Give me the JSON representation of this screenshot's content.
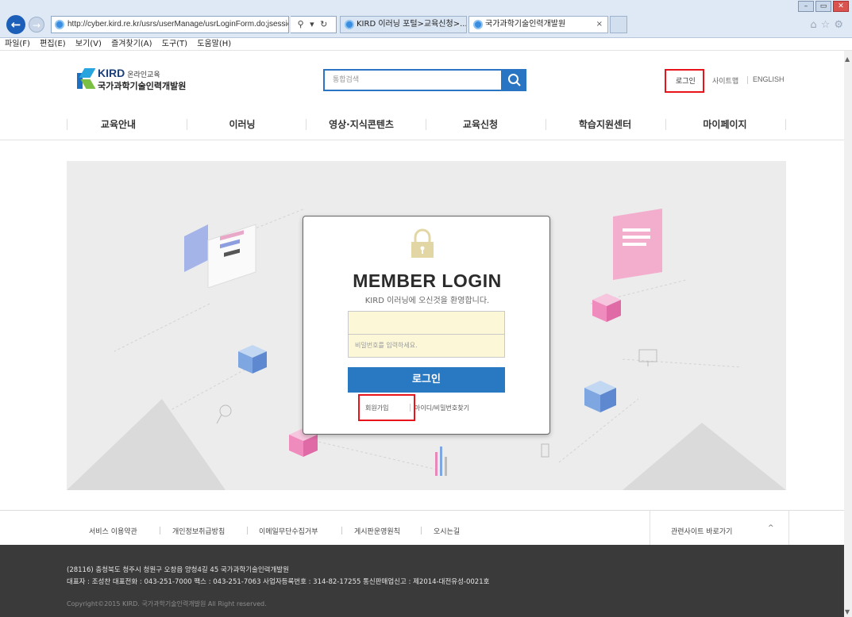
{
  "browser": {
    "url": "http://cyber.kird.re.kr/usrs/userManage/usrLoginForm.do;jsessic",
    "address_controls": "⚲ ▾ ↻",
    "tabs": [
      {
        "label": "KIRD 이러닝 포털>교육신청>...",
        "active": false
      },
      {
        "label": "국가과학기술인력개발원",
        "active": true
      }
    ],
    "tab_close": "×",
    "menu": [
      "파일(F)",
      "편집(E)",
      "보기(V)",
      "즐겨찾기(A)",
      "도구(T)",
      "도움말(H)"
    ]
  },
  "header": {
    "logo_brand": "KIRD",
    "logo_tag": "온라인교육",
    "logo_org": "국가과학기술인력개발원",
    "search_placeholder": "통합검색",
    "util": {
      "login": "로그인",
      "sitemap": "사이트맵",
      "english": "ENGLISH"
    }
  },
  "gnb": [
    "교육안내",
    "이러닝",
    "영상·지식콘텐츠",
    "교육신청",
    "학습지원센터",
    "마이페이지"
  ],
  "login": {
    "title": "MEMBER LOGIN",
    "subtitle": "KIRD 이러닝에 오신것을 환영합니다.",
    "id_value": "",
    "pw_placeholder": "비밀번호를 입력하세요.",
    "button": "로그인",
    "join": "회원가입",
    "find": "아이디/비밀번호찾기"
  },
  "footer": {
    "links": [
      "서비스 이용약관",
      "개인정보취급방침",
      "이메일무단수집거부",
      "게시판운영원칙",
      "오시는길"
    ],
    "related": "관련사이트 바로가기",
    "related_caret": "^",
    "address": "(28116) 충청북도 청주시 청원구 오창읍 양청4길 45 국가과학기술인력개발원",
    "contact": "대표자 : 조성찬   대표전화 : 043-251-7000   팩스 : 043-251-7063   사업자등록번호 : 314-82-17255   통신판매업신고 : 제2014-대전유성-0021호",
    "copyright": "Copyright©2015 KIRD. 국가과학기술인력개발원 All Right reserved."
  },
  "colors": {
    "accent": "#2979c2",
    "highlight": "#e8141b",
    "footer_bg": "#3a3a3a"
  }
}
